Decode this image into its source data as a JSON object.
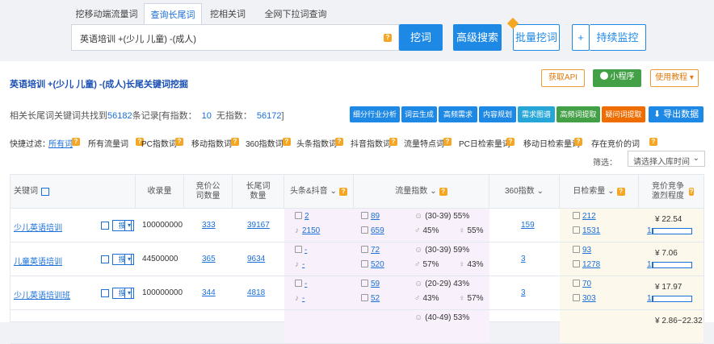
{
  "tabs": [
    "挖移动端流量词",
    "查询长尾词",
    "挖相关词",
    "全网下拉词查询"
  ],
  "search": {
    "query": "英语培训 +(少儿 儿童) -(成人)",
    "mine_button": "挖词",
    "advanced_button": "高级搜索",
    "batch_button": "批量挖词",
    "plus": "+",
    "monitor_button": "持续监控"
  },
  "panel": {
    "title": "英语培训 +(少儿 儿童) -(成人)长尾关键词挖掘",
    "api_button": "获取API",
    "mini_button": "小程序",
    "tutorial_button": "使用教程 ▾"
  },
  "summary": {
    "prefix": "相关长尾词关键词共找到",
    "total": "56182",
    "mid": "条记录[有指数：",
    "with_index": "10",
    "mid2": "无指数：",
    "without_index": "56172",
    "suffix": "]"
  },
  "function_buttons": [
    "细分行业分析",
    "词云生成",
    "高频需求",
    "内容规划",
    "需求图谱",
    "高频词提取",
    "疑问词提取",
    "导出数据"
  ],
  "function_colors": [
    "#1e88e5",
    "#1e88e5",
    "#1e88e5",
    "#1e88e5",
    "#26a6d6",
    "#43a047",
    "#ef6c00",
    "#1e88e5"
  ],
  "filters": {
    "label": "快捷过滤：",
    "items": [
      "所有词",
      "所有流量词",
      "PC指数词",
      "移动指数词",
      "360指数词",
      "头条指数词",
      "抖音指数词",
      "流量特点词",
      "PC日检索量词",
      "移动日检索量词",
      "存在竞价的词"
    ]
  },
  "screen": {
    "label": "筛选：",
    "placeholder": "请选择入库时间"
  },
  "columns": [
    "关键词",
    "收录量",
    "竞价公司数量",
    "长尾词数量",
    "头条&抖音",
    "流量指数",
    "360指数",
    "日检索量",
    "竞价竞争激烈程度"
  ],
  "rows": [
    {
      "keyword": "少儿英语培训",
      "search": "搜",
      "collect": "100000000",
      "bid": "333",
      "longtail": "39167",
      "toutiao": "2",
      "douyin": "2150",
      "flow": "89",
      "flow_m": "659",
      "age": "(30-39) 55%",
      "male": "45%",
      "female": "55%",
      "idx360": "159",
      "daily_pc": "212",
      "daily_m": "1531",
      "price": "¥ 22.54",
      "comp": "1",
      "fill": 0.02
    },
    {
      "keyword": "儿童英语培训",
      "search": "搜",
      "collect": "44500000",
      "bid": "365",
      "longtail": "9634",
      "toutiao": "-",
      "douyin": "-",
      "flow": "72",
      "flow_m": "520",
      "age": "(30-39) 59%",
      "male": "57%",
      "female": "43%",
      "idx360": "3",
      "daily_pc": "93",
      "daily_m": "1278",
      "price": "¥ 7.06",
      "comp": "1",
      "fill": 0.02
    },
    {
      "keyword": "少儿英语培训班",
      "search": "搜",
      "collect": "100000000",
      "bid": "344",
      "longtail": "4818",
      "toutiao": "-",
      "douyin": "-",
      "flow": "59",
      "flow_m": "52",
      "age": "(20-29) 43%",
      "male": "43%",
      "female": "57%",
      "idx360": "3",
      "daily_pc": "70",
      "daily_m": "303",
      "price": "¥ 17.97",
      "comp": "1",
      "fill": 0.02
    },
    {
      "keyword": "",
      "search": "",
      "collect": "",
      "bid": "",
      "longtail": "",
      "toutiao": "",
      "douyin": "",
      "flow": "",
      "flow_m": "",
      "age": "(40-49) 53%",
      "male": "",
      "female": "",
      "idx360": "",
      "daily_pc": "",
      "daily_m": "",
      "price": "¥ 2.86~22.32",
      "comp": "",
      "fill": 0
    }
  ]
}
